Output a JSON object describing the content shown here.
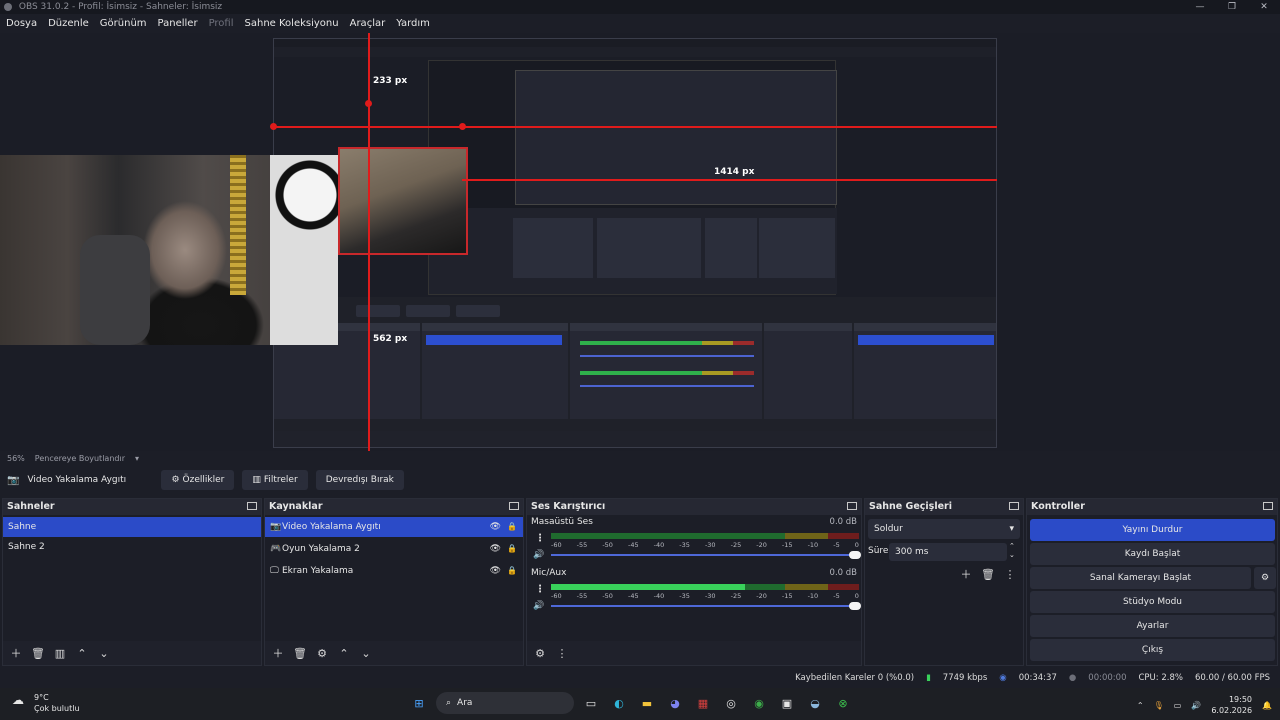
{
  "window": {
    "title": "OBS 31.0.2 - Profil: İsimsiz - Sahneler: İsimsiz",
    "controls": [
      "—",
      "❐",
      "✕"
    ]
  },
  "menu": [
    "Dosya",
    "Düzenle",
    "Görünüm",
    "Paneller",
    "Profil",
    "Sahne Koleksiyonu",
    "Araçlar",
    "Yardım"
  ],
  "preview": {
    "labels": {
      "top_px": "233 px",
      "bottom_px": "562 px",
      "right_px": "1414 px"
    },
    "guide_color": "#e01b1b"
  },
  "zoom": {
    "percent": "56%",
    "mode": "Pencereye Boyutlandır"
  },
  "source_toolbar": {
    "source_name": "Video Yakalama Aygıtı",
    "properties": "Özellikler",
    "filters": "Filtreler",
    "deactivate": "Devredışı Bırak"
  },
  "scenes": {
    "title": "Sahneler",
    "items": [
      "Sahne",
      "Sahne 2"
    ]
  },
  "sources": {
    "title": "Kaynaklar",
    "items": [
      {
        "icon": "camera-icon",
        "label": "Video Yakalama Aygıtı"
      },
      {
        "icon": "gamepad-icon",
        "label": "Oyun Yakalama 2"
      },
      {
        "icon": "monitor-icon",
        "label": "Ekran Yakalama"
      }
    ]
  },
  "mixer": {
    "title": "Ses Karıştırıcı",
    "scale": [
      "-60",
      "-55",
      "-50",
      "-45",
      "-40",
      "-35",
      "-30",
      "-25",
      "-20",
      "-15",
      "-10",
      "-5",
      "0"
    ],
    "channels": [
      {
        "name": "Masaüstü Ses",
        "db": "0.0 dB",
        "level": 0
      },
      {
        "name": "Mic/Aux",
        "db": "0.0 dB",
        "level": 0.63
      }
    ]
  },
  "transitions": {
    "title": "Sahne Geçişleri",
    "selected": "Soldur",
    "duration_label": "Süre",
    "duration": "300 ms"
  },
  "controls": {
    "title": "Kontroller",
    "buttons": [
      "Yayını Durdur",
      "Kaydı Başlat",
      "Sanal Kamerayı Başlat",
      "Stüdyo Modu",
      "Ayarlar",
      "Çıkış"
    ]
  },
  "status": {
    "dropped": "Kaybedilen Kareler 0 (%0.0)",
    "bitrate": "7749 kbps",
    "stream_time": "00:34:37",
    "rec_time": "00:00:00",
    "cpu": "CPU: 2.8%",
    "fps": "60.00 / 60.00 FPS"
  },
  "taskbar": {
    "weather_temp": "9°C",
    "weather_desc": "Çok bulutlu",
    "search": "Ara",
    "time": "19:50",
    "date": "6.02.2026"
  }
}
